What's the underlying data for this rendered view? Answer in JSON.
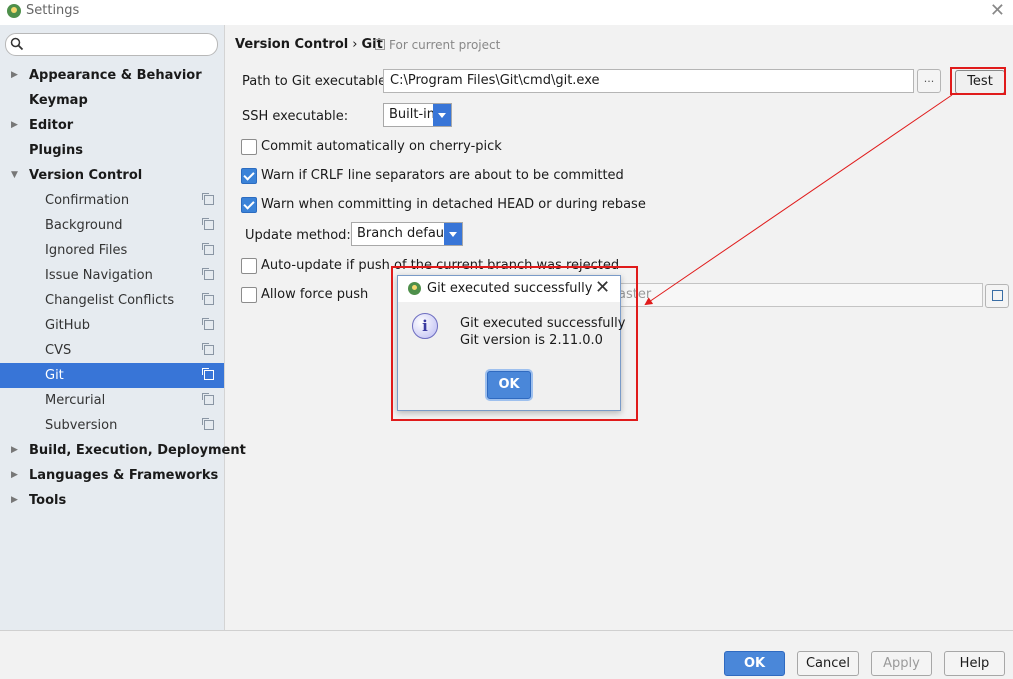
{
  "window": {
    "title": "Settings",
    "close_glyph": "✕"
  },
  "search": {
    "placeholder": ""
  },
  "sidebar": {
    "items": [
      {
        "label": "Appearance & Behavior",
        "level": 0,
        "expandable": true,
        "expanded": false
      },
      {
        "label": "Keymap",
        "level": 0,
        "expandable": false
      },
      {
        "label": "Editor",
        "level": 0,
        "expandable": true,
        "expanded": false
      },
      {
        "label": "Plugins",
        "level": 0,
        "expandable": false
      },
      {
        "label": "Version Control",
        "level": 0,
        "expandable": true,
        "expanded": true
      },
      {
        "label": "Confirmation",
        "level": 1
      },
      {
        "label": "Background",
        "level": 1
      },
      {
        "label": "Ignored Files",
        "level": 1
      },
      {
        "label": "Issue Navigation",
        "level": 1
      },
      {
        "label": "Changelist Conflicts",
        "level": 1
      },
      {
        "label": "GitHub",
        "level": 1
      },
      {
        "label": "CVS",
        "level": 1
      },
      {
        "label": "Git",
        "level": 1,
        "selected": true
      },
      {
        "label": "Mercurial",
        "level": 1
      },
      {
        "label": "Subversion",
        "level": 1
      },
      {
        "label": "Build, Execution, Deployment",
        "level": 0,
        "expandable": true,
        "expanded": false
      },
      {
        "label": "Languages & Frameworks",
        "level": 0,
        "expandable": true,
        "expanded": false
      },
      {
        "label": "Tools",
        "level": 0,
        "expandable": true,
        "expanded": false
      }
    ]
  },
  "breadcrumb": {
    "parent": "Version Control",
    "separator": "›",
    "current": "Git",
    "note": "For current project"
  },
  "form": {
    "path_label": "Path to Git executable:",
    "path_value": "C:\\Program Files\\Git\\cmd\\git.exe",
    "browse_label": "...",
    "test_label": "Test",
    "ssh_label": "SSH executable:",
    "ssh_value": "Built-in",
    "commit_cherry_label": "Commit automatically on cherry-pick",
    "commit_cherry_checked": false,
    "warn_crlf_label": "Warn if CRLF line separators are about to be committed",
    "warn_crlf_checked": true,
    "warn_detached_label": "Warn when committing in detached HEAD or during rebase",
    "warn_detached_checked": true,
    "update_method_label": "Update method:",
    "update_method_value": "Branch default",
    "auto_update_label": "Auto-update if push of the current branch was rejected",
    "auto_update_checked": false,
    "force_push_label": "Allow force push",
    "force_push_checked": false,
    "protected_branches_value": "aster"
  },
  "dialog": {
    "title": "Git executed successfully",
    "close_glyph": "✕",
    "message_line1": "Git executed successfully",
    "message_line2": "Git version is 2.11.0.0",
    "ok_label": "OK",
    "icon": "info-icon"
  },
  "footer": {
    "ok_label": "OK",
    "cancel_label": "Cancel",
    "apply_label": "Apply",
    "help_label": "Help"
  },
  "colors": {
    "selection": "#3875d7",
    "highlight": "#e01b1b",
    "primary_button": "#4a87d9"
  }
}
